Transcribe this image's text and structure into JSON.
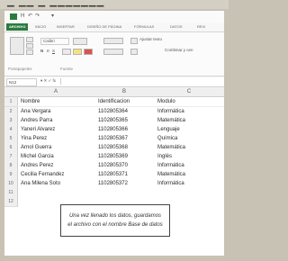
{
  "quick_access": {
    "save_label": "H",
    "undo_label": "↶",
    "redo_label": "↷",
    "misc_label": "▾"
  },
  "tabs": [
    "ARCHIVO",
    "INICIO",
    "INSERTAR",
    "DISEÑO DE PÁGINA",
    "FÓRMULAS",
    "DATOS",
    "REVI"
  ],
  "ribbon": {
    "font_name": "Calibri",
    "bold": "N",
    "italic": "K",
    "underline": "S",
    "wrap_text": "Ajustar texto",
    "merge": "Combinar y cen",
    "clipboard_group": "Portapapeles",
    "font_group": "Fuente"
  },
  "formula_bar": {
    "name_box": "N12"
  },
  "columns": [
    "A",
    "B",
    "C"
  ],
  "rows": [
    {
      "n": "1",
      "a": "Nombre",
      "b": "Identificacion",
      "c": "Modulo"
    },
    {
      "n": "2",
      "a": "Ana Vergara",
      "b": "1102805364",
      "c": "Informática"
    },
    {
      "n": "3",
      "a": "Andres Parra",
      "b": "1102805365",
      "c": "Matemática"
    },
    {
      "n": "4",
      "a": "Yaneri Alvarez",
      "b": "1102805366",
      "c": "Lenguaje"
    },
    {
      "n": "5",
      "a": "Yina Perez",
      "b": "1102805367",
      "c": "Química"
    },
    {
      "n": "6",
      "a": "Arnol Guerra",
      "b": "1102805368",
      "c": "Matemática"
    },
    {
      "n": "7",
      "a": "Michel Garcia",
      "b": "1102805369",
      "c": "Inglés"
    },
    {
      "n": "8",
      "a": "Andres Perez",
      "b": "1102805370",
      "c": "Informática"
    },
    {
      "n": "9",
      "a": "Cecilia Fernandez",
      "b": "1102805371",
      "c": "Matemática"
    },
    {
      "n": "10",
      "a": "Ana Milena Soto",
      "b": "1102805372",
      "c": "Informática"
    },
    {
      "n": "11",
      "a": "",
      "b": "",
      "c": ""
    },
    {
      "n": "12",
      "a": "",
      "b": "",
      "c": ""
    }
  ],
  "note": {
    "line1": "Una vez llenado los datos, guardamos",
    "line2": "el archivo con el nombre Base de datos"
  },
  "colors": {
    "accent": "#2b7a3e"
  }
}
